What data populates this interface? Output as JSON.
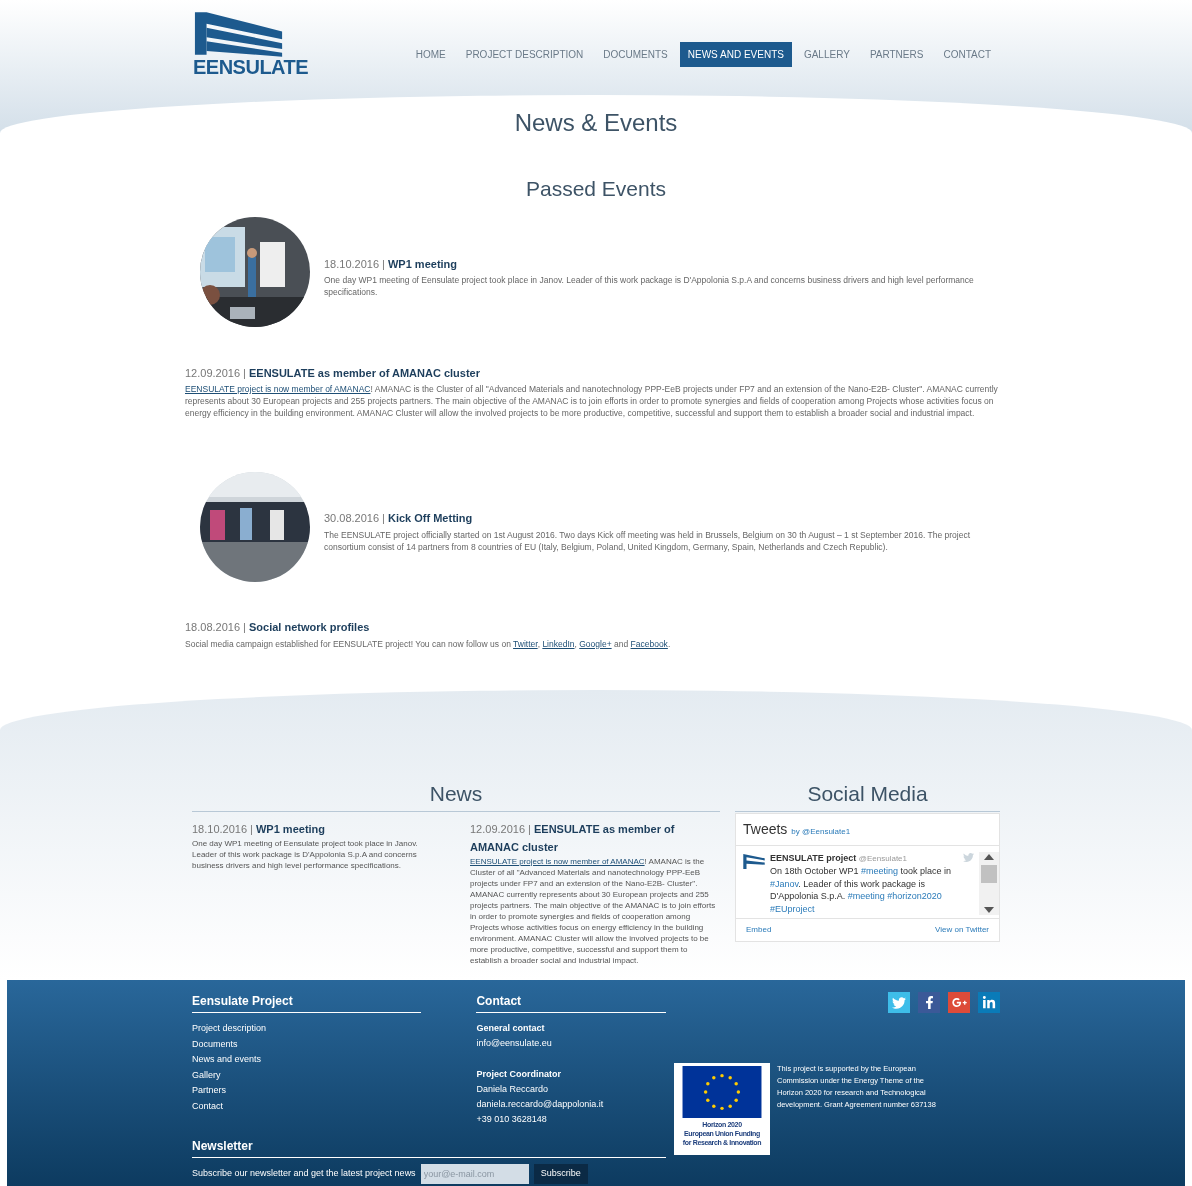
{
  "logo": {
    "text": "EENSULATE"
  },
  "nav": [
    {
      "label": "HOME",
      "selected": false
    },
    {
      "label": "PROJECT DESCRIPTION",
      "selected": false
    },
    {
      "label": "DOCUMENTS",
      "selected": false
    },
    {
      "label": "NEWS AND EVENTS",
      "selected": true
    },
    {
      "label": "GALLERY",
      "selected": false
    },
    {
      "label": "PARTNERS",
      "selected": false
    },
    {
      "label": "CONTACT",
      "selected": false
    }
  ],
  "page_title": "News & Events",
  "section_title": "Passed Events",
  "events": [
    {
      "kind": "with-picture",
      "date": "18.10.2016 |",
      "title": "WP1 meeting",
      "body": [
        {
          "text": "One day WP1 meeting of Eensulate project took place in Janov. Leader of this work package is D'Appolonia S.p.A and concerns business drivers and high level performance specifications.",
          "link": false
        }
      ]
    },
    {
      "kind": "text-only",
      "date": "12.09.2016 |",
      "title": "EENSULATE as member of AMANAC cluster",
      "body": [
        {
          "text": "EENSULATE project is now member of AMANAC",
          "link": true
        },
        {
          "text": "! AMANAC is the Cluster of all \"Advanced Materials and nanotechnology PPP-EeB projects under FP7 and an extension of the Nano-E2B- Cluster\". AMANAC currently represents about 30 European projects and 255 projects partners. The main objective of the AMANAC is to join efforts in order to promote synergies and fields of cooperation among Projects whose activities focus on energy efficiency in the building environment. AMANAC Cluster will allow the involved projects to be more productive, competitive, successful and support them to establish a broader social and industrial impact.",
          "link": false
        }
      ]
    },
    {
      "kind": "with-picture",
      "date": "30.08.2016 |",
      "title": "Kick Off Metting",
      "body": [
        {
          "text": "The EENSULATE project officially started on 1st August 2016. Two days Kick off meeting was held in Brussels, Belgium on 30 th August – 1 st September 2016. The project consortium consist of 14 partners from 8 countries of EU (Italy, Belgium, Poland, United Kingdom, Germany, Spain, Netherlands and Czech Republic).",
          "link": false
        }
      ]
    },
    {
      "kind": "text-only",
      "date": "18.08.2016 |",
      "title": "Social network profiles",
      "body": [
        {
          "text": "Social media campaign established for EENSULATE project! You can now follow us on ",
          "link": false
        },
        {
          "text": "Twitter",
          "link": true
        },
        {
          "text": ", ",
          "link": false
        },
        {
          "text": "LinkedIn",
          "link": true
        },
        {
          "text": ", ",
          "link": false
        },
        {
          "text": "Google+",
          "link": true
        },
        {
          "text": " and ",
          "link": false
        },
        {
          "text": "Facebook",
          "link": true
        },
        {
          "text": ".",
          "link": false
        }
      ]
    }
  ],
  "news": {
    "title": "News",
    "items": [
      {
        "date": "18.10.2016 |",
        "title": "WP1 meeting",
        "body": [
          {
            "text": "One day WP1 meeting of Eensulate project took place in Janov. Leader of this work package is D'Appolonia S.p.A and concerns business drivers and high level performance specifications.",
            "link": false
          }
        ]
      },
      {
        "date": "12.09.2016 |",
        "title": "EENSULATE as member of AMANAC cluster",
        "body": [
          {
            "text": "EENSULATE project is now member of AMANAC",
            "link": true
          },
          {
            "text": "! AMANAC is the Cluster of all \"Advanced Materials and nanotechnology PPP-EeB projects under FP7 and an extension of the Nano-E2B- Cluster\". AMANAC currently represents about 30 European projects and 255 projects partners. The main objective of the AMANAC is to join efforts in order to promote synergies and fields of cooperation among Projects whose activities focus on energy efficiency in the building environment. AMANAC Cluster will allow the involved projects to be more productive, competitive, successful and support them to establish a broader social and industrial impact.",
            "link": false
          }
        ]
      }
    ]
  },
  "social": {
    "title": "Social Media",
    "widget_title": "Tweets",
    "by": "by @Eensulate1",
    "tweet": {
      "author": "EENSULATE project",
      "handle": "@Eensulate1",
      "text": [
        {
          "text": "On 18th October WP1 ",
          "link": false
        },
        {
          "text": "#meeting",
          "link": true
        },
        {
          "text": " took place in ",
          "link": false
        },
        {
          "text": "#Janov",
          "link": true
        },
        {
          "text": ". Leader of this work package is D'Appolonia S.p.A.  ",
          "link": false
        },
        {
          "text": "#meeting",
          "link": true
        },
        {
          "text": "#horizon2020",
          "link": true
        },
        {
          "text": "#EUproject",
          "link": true
        }
      ]
    },
    "embed": "Embed",
    "view": "View on Twitter"
  },
  "footer": {
    "project": {
      "title": "Eensulate Project",
      "links": [
        "Project description",
        "Documents",
        "News and events",
        "Gallery",
        "Partners",
        "Contact"
      ]
    },
    "contact": {
      "title": "Contact",
      "groups": [
        {
          "heading": "General contact",
          "lines": [
            "info@eensulate.eu"
          ]
        },
        {
          "heading": "Project Coordinator",
          "lines": [
            "Daniela Reccardo",
            "daniela.reccardo@dappolonia.it",
            "+39 010 3628148"
          ]
        }
      ]
    },
    "newsletter": {
      "title": "Newsletter",
      "text": "Subscribe our newsletter and get the latest project news",
      "placeholder": "your@e-mail.com",
      "button": "Subscribe"
    },
    "eu": {
      "caption": [
        "Horizon 2020",
        "European Union Funding",
        "for Research & Innovation"
      ],
      "text": "This project is supported by the European Commission under the Energy Theme of the Horizon 2020 for research and Technological development. Grant Agreement number 637138"
    }
  }
}
